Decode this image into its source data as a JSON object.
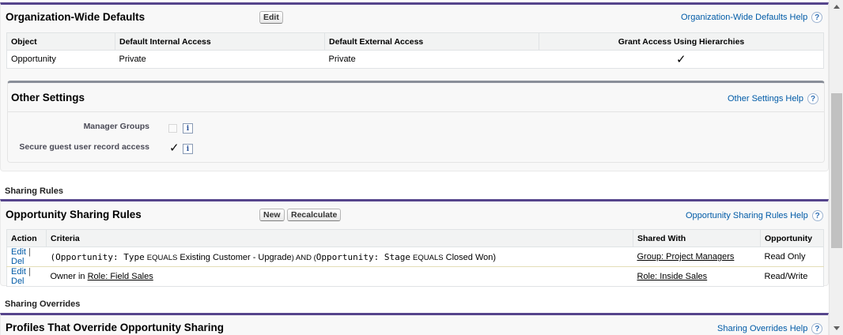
{
  "org_defaults": {
    "title": "Organization-Wide Defaults",
    "edit_label": "Edit",
    "help_label": "Organization-Wide Defaults Help",
    "columns": [
      "Object",
      "Default Internal Access",
      "Default External Access",
      "Grant Access Using Hierarchies"
    ],
    "row": {
      "object": "Opportunity",
      "internal": "Private",
      "external": "Private",
      "grant": "✓"
    }
  },
  "other_settings": {
    "title": "Other Settings",
    "help_label": "Other Settings Help",
    "manager_groups_label": "Manager Groups",
    "manager_groups_checked": false,
    "secure_guest_label": "Secure guest user record access",
    "secure_guest_checked": true,
    "check_glyph": "✓",
    "info_glyph": "i"
  },
  "sharing_rules": {
    "section_label": "Sharing Rules",
    "title": "Opportunity Sharing Rules",
    "new_label": "New",
    "recalculate_label": "Recalculate",
    "help_label": "Opportunity Sharing Rules Help",
    "columns": [
      "Action",
      "Criteria",
      "Shared With",
      "Opportunity"
    ],
    "edit_label": "Edit",
    "sep": "|",
    "del_label": "Del",
    "row1": {
      "open_paren": "(",
      "field1": "Opportunity: Type",
      "op1": "EQUALS",
      "val1": "Existing Customer - Upgrade",
      "mid": ") AND (",
      "field2": "Opportunity: Stage",
      "op2": "EQUALS",
      "val2": "Closed Won",
      "close_paren": ")",
      "shared_with": "Group: Project Managers",
      "access": "Read Only"
    },
    "row2": {
      "prefix": "Owner in",
      "role_link": "Role: Field Sales",
      "shared_with": "Role: Inside Sales",
      "access": "Read/Write"
    }
  },
  "overrides": {
    "section_label": "Sharing Overrides",
    "title": "Profiles That Override Opportunity Sharing",
    "help_label": "Sharing Overrides Help"
  },
  "help_glyph": "?",
  "colors": {
    "accent": "#56458c",
    "link": "#015ba7"
  }
}
